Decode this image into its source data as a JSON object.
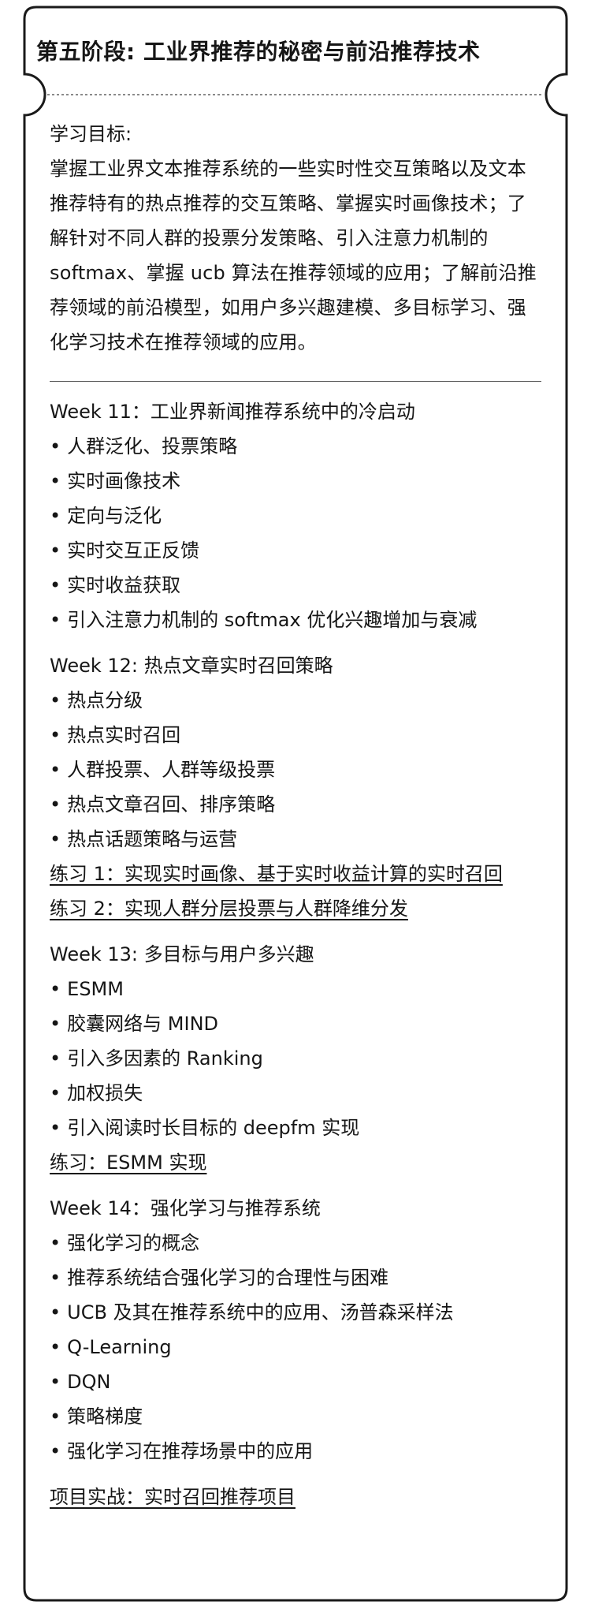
{
  "title": "第五阶段: 工业界推荐的秘密与前沿推荐技术",
  "goal": {
    "label": "学习目标:",
    "text": "掌握工业界文本推荐系统的一些实时性交互策略以及文本推荐特有的热点推荐的交互策略、掌握实时画像技术；了解针对不同人群的投票分发策略、引入注意力机制的 softmax、掌握 ucb 算法在推荐领域的应用；了解前沿推荐领域的前沿模型，如用户多兴趣建模、多目标学习、强化学习技术在推荐领域的应用。"
  },
  "weeks": [
    {
      "title": "Week 11：工业界新闻推荐系统中的冷启动",
      "items": [
        "人群泛化、投票策略",
        "实时画像技术",
        "定向与泛化",
        "实时交互正反馈",
        "实时收益获取",
        "引入注意力机制的 softmax 优化兴趣增加与衰减"
      ],
      "exercises": []
    },
    {
      "title": "Week 12: 热点文章实时召回策略",
      "items": [
        "热点分级",
        "热点实时召回",
        "人群投票、人群等级投票",
        "热点文章召回、排序策略",
        "热点话题策略与运营"
      ],
      "exercises": [
        "练习 1：实现实时画像、基于实时收益计算的实时召回",
        "练习 2：实现人群分层投票与人群降维分发"
      ]
    },
    {
      "title": "Week 13: 多目标与用户多兴趣",
      "items": [
        "ESMM",
        "胶囊网络与 MIND",
        "引入多因素的 Ranking",
        "加权损失",
        "引入阅读时长目标的 deepfm 实现"
      ],
      "exercises": [
        "练习：ESMM 实现"
      ]
    },
    {
      "title": "Week 14：强化学习与推荐系统",
      "items": [
        "强化学习的概念",
        "推荐系统结合强化学习的合理性与困难",
        "UCB 及其在推荐系统中的应用、汤普森采样法",
        "Q-Learning",
        "DQN",
        "策略梯度",
        "强化学习在推荐场景中的应用"
      ],
      "exercises": []
    }
  ],
  "project": "项目实战：实时召回推荐项目",
  "bullet": "•"
}
